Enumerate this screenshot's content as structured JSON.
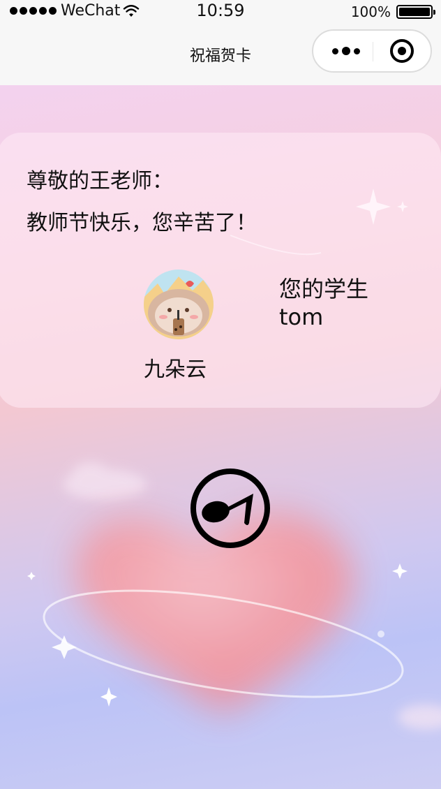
{
  "status_bar": {
    "carrier": "WeChat",
    "time": "10:59",
    "battery": "100%"
  },
  "nav": {
    "title": "祝福贺卡"
  },
  "card": {
    "greeting": "尊敬的王老师：",
    "message": "教师节快乐，您辛苦了！",
    "sender_nickname": "九朵云",
    "signature_line1": "您的学生",
    "signature_line2": "tom"
  },
  "icons": {
    "music": "music-note-icon",
    "more": "more-dots-icon",
    "close": "target-circle-icon"
  },
  "colors": {
    "bg_top": "#f3d2ef",
    "bg_bottom": "#bcc3f6",
    "heart": "#f28f9a",
    "bar": "#f7f7f7"
  }
}
